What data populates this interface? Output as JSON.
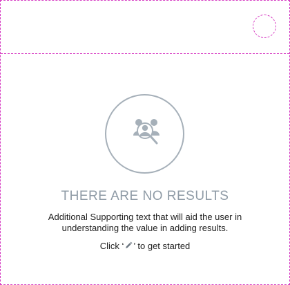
{
  "empty_state": {
    "title": "THERE ARE NO RESULTS",
    "description": "Additional Supporting text that will aid the user in understanding the value in adding results.",
    "cta_prefix": "Click ‘",
    "cta_icon": "pencil-icon",
    "cta_suffix": "’ to get started",
    "illustration_icon": "people-search-icon"
  },
  "colors": {
    "outline_dashed": "#d63ac2",
    "icon_gray": "#8f9ba6",
    "text_dark": "#1f1f1f"
  }
}
